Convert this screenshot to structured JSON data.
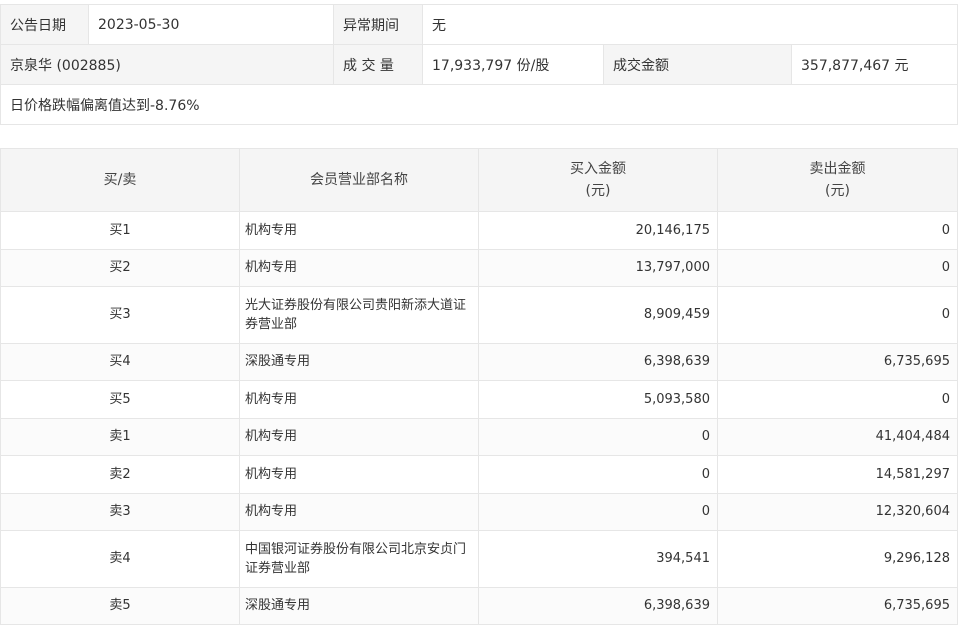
{
  "info": {
    "announce_date_label": "公告日期",
    "announce_date": "2023-05-30",
    "abnormal_period_label": "异常期间",
    "abnormal_period": "无",
    "stock": "京泉华 (002885)",
    "volume_label": "成 交 量",
    "volume": "17,933,797 份/股",
    "amount_label": "成交金额",
    "amount": "357,877,467 元",
    "reason": "日价格跌幅偏离值达到-8.76%"
  },
  "trade": {
    "headers": {
      "side": "买/卖",
      "branch": "会员营业部名称",
      "buy_line1": "买入金额",
      "buy_line2": "(元)",
      "sell_line1": "卖出金额",
      "sell_line2": "(元)"
    },
    "rows": [
      {
        "side": "买1",
        "branch": "机构专用",
        "buy": "20,146,175",
        "sell": "0"
      },
      {
        "side": "买2",
        "branch": "机构专用",
        "buy": "13,797,000",
        "sell": "0"
      },
      {
        "side": "买3",
        "branch": "光大证券股份有限公司贵阳新添大道证券营业部",
        "buy": "8,909,459",
        "sell": "0"
      },
      {
        "side": "买4",
        "branch": "深股通专用",
        "buy": "6,398,639",
        "sell": "6,735,695"
      },
      {
        "side": "买5",
        "branch": "机构专用",
        "buy": "5,093,580",
        "sell": "0"
      },
      {
        "side": "卖1",
        "branch": "机构专用",
        "buy": "0",
        "sell": "41,404,484"
      },
      {
        "side": "卖2",
        "branch": "机构专用",
        "buy": "0",
        "sell": "14,581,297"
      },
      {
        "side": "卖3",
        "branch": "机构专用",
        "buy": "0",
        "sell": "12,320,604"
      },
      {
        "side": "卖4",
        "branch": "中国银河证券股份有限公司北京安贞门证券营业部",
        "buy": "394,541",
        "sell": "9,296,128"
      },
      {
        "side": "卖5",
        "branch": "深股通专用",
        "buy": "6,398,639",
        "sell": "6,735,695"
      }
    ]
  },
  "colors": {
    "header_bg": "#f5f5f5",
    "border": "#e6e6e6",
    "text": "#333333"
  }
}
